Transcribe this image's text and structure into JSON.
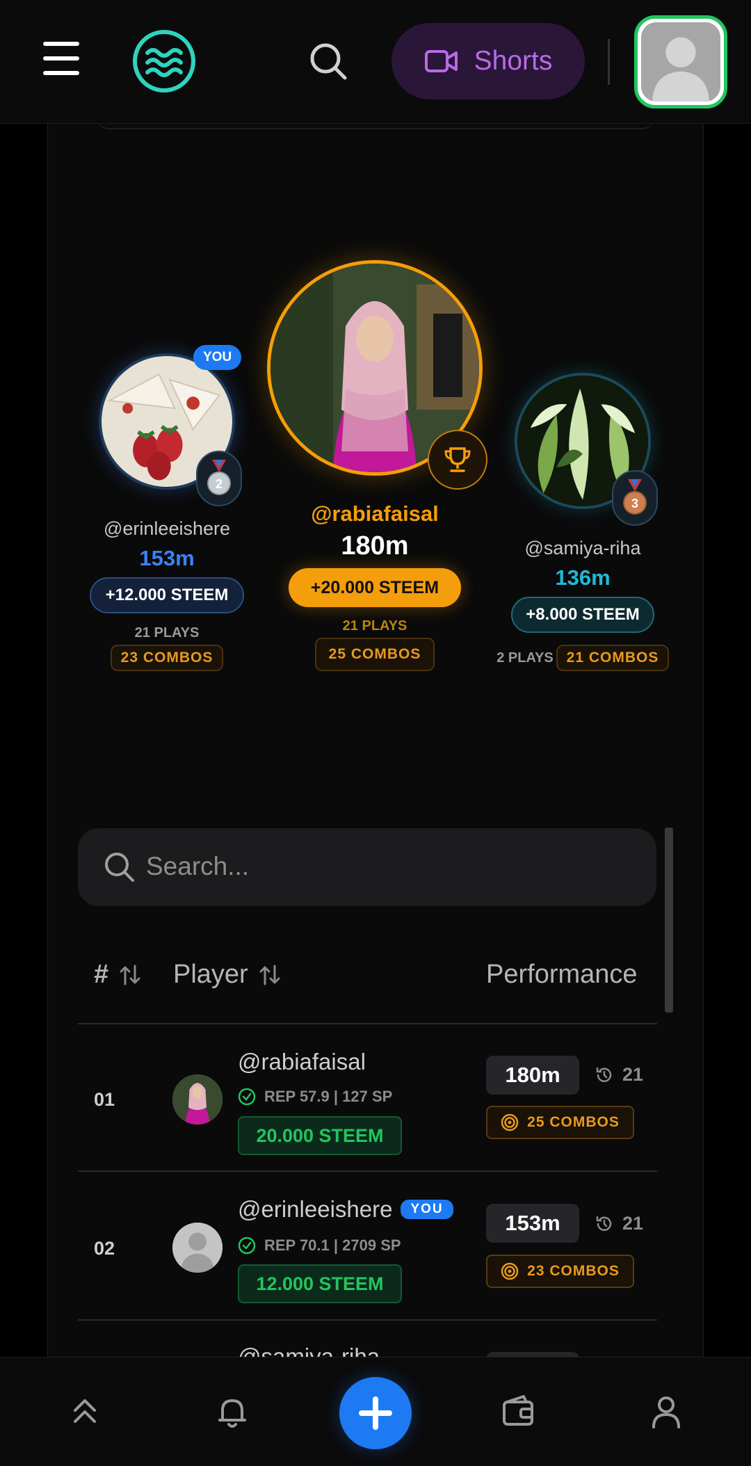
{
  "header": {
    "shorts_label": "Shorts"
  },
  "podium": {
    "first": {
      "username": "@rabiafaisal",
      "metric": "180m",
      "reward": "+20.000 STEEM",
      "plays": "21 PLAYS",
      "combos": "25 COMBOS"
    },
    "second": {
      "you_badge": "YOU",
      "username": "@erinleeishere",
      "metric": "153m",
      "reward": "+12.000 STEEM",
      "plays": "21 PLAYS",
      "combos": "23 COMBOS",
      "medal_number": "2"
    },
    "third": {
      "username": "@samiya-riha",
      "metric": "136m",
      "reward": "+8.000 STEEM",
      "plays": "2 PLAYS",
      "combos": "21 COMBOS",
      "medal_number": "3"
    }
  },
  "search": {
    "placeholder": "Search..."
  },
  "table": {
    "headers": {
      "rank": "#",
      "player": "Player",
      "performance": "Performance"
    },
    "rows": [
      {
        "rank": "01",
        "username": "@rabiafaisal",
        "you": "",
        "rep": "REP 57.9 | 127 SP",
        "steem": "20.000 STEEM",
        "metric": "180m",
        "plays": "21",
        "combos": "25 COMBOS"
      },
      {
        "rank": "02",
        "username": "@erinleeishere",
        "you": "YOU",
        "rep": "REP 70.1 | 2709 SP",
        "steem": "12.000 STEEM",
        "metric": "153m",
        "plays": "21",
        "combos": "23 COMBOS"
      },
      {
        "rank": "",
        "username": "@samiya-riha",
        "partially_visible": true
      }
    ]
  },
  "colors": {
    "accent_blue": "#1d7af3",
    "gold": "#f59e0b",
    "green": "#22c55e",
    "cyan": "#22b8d8",
    "purple": "#b86be6"
  },
  "icons": {
    "nav": [
      "chevrons-up-icon",
      "bell-icon",
      "plus-icon",
      "wallet-icon",
      "user-icon"
    ]
  }
}
